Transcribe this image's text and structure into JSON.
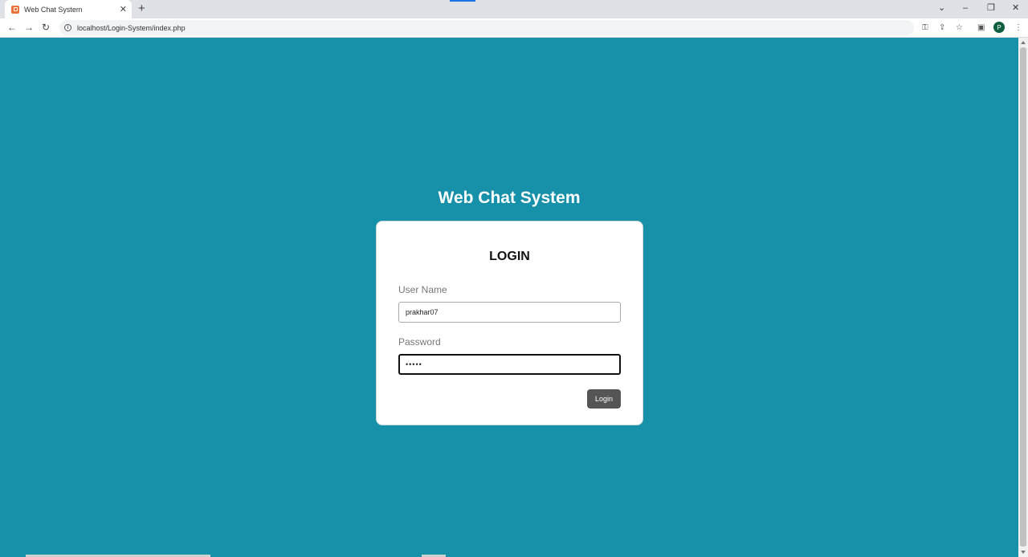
{
  "browser": {
    "tab_title": "Web Chat System",
    "tab_close": "✕",
    "new_tab": "+",
    "url": "localhost/Login-System/index.php",
    "profile_initial": "P",
    "window_controls": {
      "tabs_dropdown": "⌄",
      "minimize": "–",
      "restore": "❐",
      "close": "✕"
    },
    "nav": {
      "back": "←",
      "forward": "→",
      "reload": "↻"
    },
    "tools": {
      "key": "⚿",
      "share": "⇪",
      "bookmark": "☆",
      "sidepanel": "▣",
      "menu": "⋮"
    }
  },
  "page": {
    "background": "#1791a9",
    "site_title": "Web Chat System",
    "login_form": {
      "heading": "LOGIN",
      "username_label": "User Name",
      "username_value": "prakhar07",
      "password_label": "Password",
      "password_value": "•••••",
      "submit_label": "Login"
    }
  }
}
